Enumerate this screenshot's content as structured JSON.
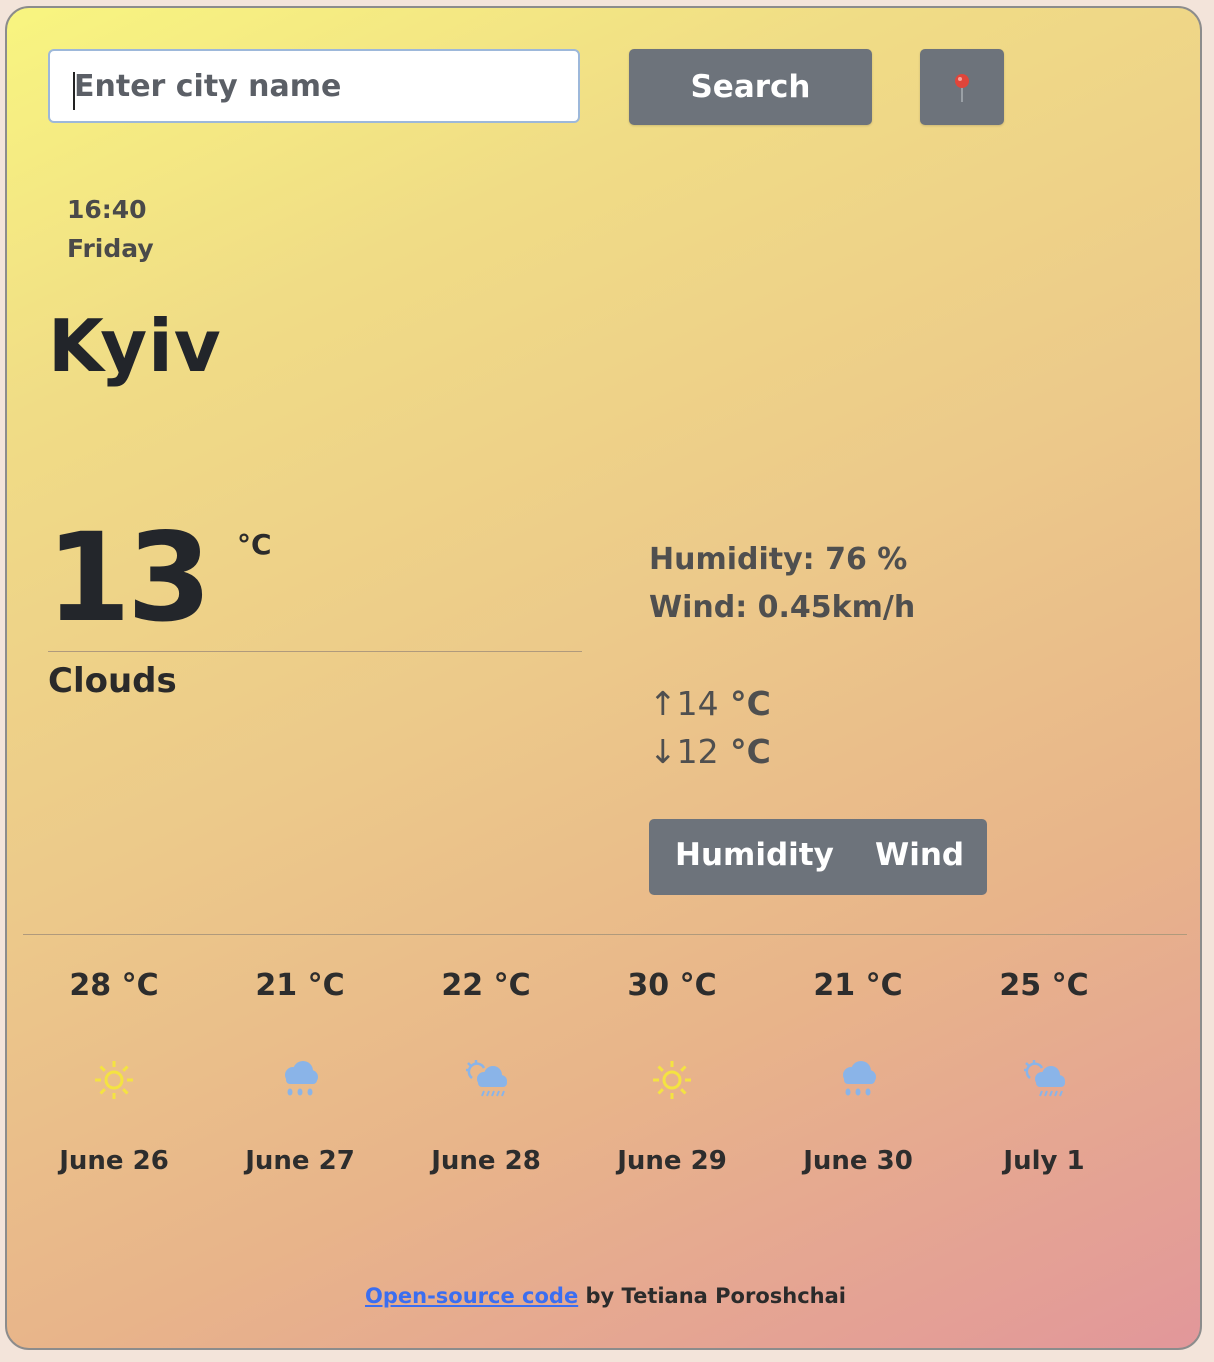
{
  "search": {
    "placeholder": "Enter city name",
    "button_label": "Search",
    "location_icon": "pin-icon"
  },
  "current": {
    "time": "16:40",
    "day": "Friday",
    "city": "Kyiv",
    "temperature": "13",
    "unit": "°C",
    "description": "Clouds",
    "humidity": "Humidity: 76 %",
    "wind": "Wind: 0.45km/h",
    "max_arrow": "↑",
    "max_value": "14",
    "min_arrow": "↓",
    "min_value": "12",
    "minmax_unit": " °C"
  },
  "toggle": {
    "humidity_label": "Humidity",
    "wind_label": "Wind"
  },
  "forecast": [
    {
      "temp": "28 °C",
      "icon": "sun-icon",
      "date": "June 26"
    },
    {
      "temp": "21 °C",
      "icon": "rain-cloud-icon",
      "date": "June 27"
    },
    {
      "temp": "22 °C",
      "icon": "sun-cloud-rain-icon",
      "date": "June 28"
    },
    {
      "temp": "30 °C",
      "icon": "sun-icon",
      "date": "June 29"
    },
    {
      "temp": "21 °C",
      "icon": "rain-cloud-icon",
      "date": "June 30"
    },
    {
      "temp": "25 °C",
      "icon": "sun-cloud-rain-icon",
      "date": "July 1"
    }
  ],
  "footer": {
    "link_text": "Open-source code",
    "suffix": " by Tetiana Poroshchai"
  },
  "colors": {
    "button": "#6d737b",
    "link": "#3b6ef0",
    "sun": "#f4e341",
    "rain": "#8ab4e8"
  }
}
